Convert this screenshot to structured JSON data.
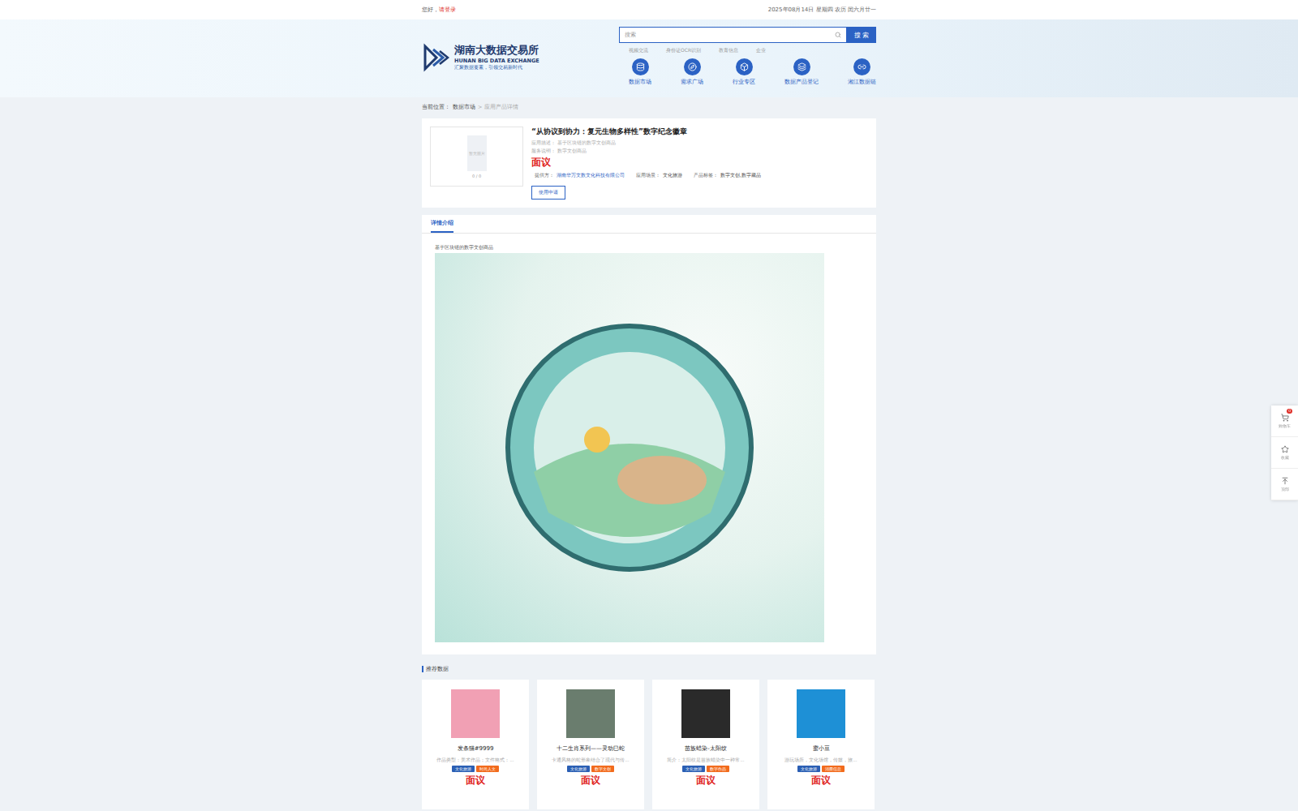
{
  "top_bar": {
    "greeting": "您好，",
    "login": "请登录",
    "date": "2025年08月14日 星期四 农历 闰六月廿一"
  },
  "logo": {
    "name": "湖南大数据交易所",
    "english": "HUNAN BIG DATA EXCHANGE",
    "slogan": "汇聚数据要素，引领交易新时代"
  },
  "search": {
    "placeholder": "搜索",
    "button": "搜 索",
    "hot_words": [
      "视频交流",
      "身份证OCR识别",
      "教育信息",
      "企业"
    ]
  },
  "nav": [
    {
      "label": "数据市场"
    },
    {
      "label": "需求广场"
    },
    {
      "label": "行业专区"
    },
    {
      "label": "数据产品登记"
    },
    {
      "label": "湘江数据链"
    }
  ],
  "breadcrumb": {
    "prefix": "当前位置：",
    "separator": ">",
    "items": [
      "数据市场",
      "应用产品详情"
    ]
  },
  "product": {
    "title": "“从协议到协力：复元生物多样性”数字纪念徽章",
    "image_placeholder": "暂无图片",
    "image_counter": "0 / 0",
    "fields": [
      {
        "label": "应用描述：",
        "value": "基于区块链的数字文创商品"
      },
      {
        "label": "服务说明：",
        "value": "数字文创商品"
      }
    ],
    "price": "面议",
    "meta": [
      {
        "label": "提供方：",
        "value": "湖南华万文数文化科技有限公司",
        "link": true
      },
      {
        "label": "应用场景：",
        "value": "文化旅游",
        "link": false
      },
      {
        "label": "产品标签：",
        "value": "数字文创,数字藏品",
        "link": false
      }
    ],
    "apply_button": "使用申请"
  },
  "tabs": [
    {
      "label": "详情介绍",
      "selected": true
    }
  ],
  "detail": {
    "text": "基于区块链的数字文创商品"
  },
  "recommend": {
    "title": "推荐数据",
    "cards": [
      {
        "title": "发条猫#9999",
        "desc": "作品类型：美术作品；文件格式：...",
        "price": "面议",
        "image_color": "#f1a0b4",
        "tags": [
          {
            "label": "文化旅游",
            "color": "#2b5fb4"
          },
          {
            "label": "时尚人文",
            "color": "#f26b1d"
          }
        ]
      },
      {
        "title": "十二生肖系列——灵动巳蛇",
        "desc": "卡通风格的蛇形象结合了现代与传...",
        "price": "面议",
        "image_color": "#6a7d6e",
        "tags": [
          {
            "label": "文化旅游",
            "color": "#2b5fb4"
          },
          {
            "label": "数字文创",
            "color": "#f26b1d"
          }
        ]
      },
      {
        "title": "苗族蜡染-太阳纹",
        "desc": "简介：太阳纹是苗族蜡染中一种常...",
        "price": "面议",
        "image_color": "#2a2a2a",
        "tags": [
          {
            "label": "文化旅游",
            "color": "#2b5fb4"
          },
          {
            "label": "数字作品",
            "color": "#f26b1d"
          }
        ]
      },
      {
        "title": "蜜小豆",
        "desc": "游玩场所，文化场馆，传媒，旅...",
        "price": "面议",
        "image_color": "#1e90d6",
        "tags": [
          {
            "label": "文化旅游",
            "color": "#2b5fb4"
          },
          {
            "label": "消费信息",
            "color": "#f26b1d"
          }
        ]
      }
    ]
  },
  "side_tools": [
    {
      "label": "购物车",
      "badge": "0"
    },
    {
      "label": "收藏",
      "badge": ""
    },
    {
      "label": "顶部",
      "badge": ""
    }
  ]
}
